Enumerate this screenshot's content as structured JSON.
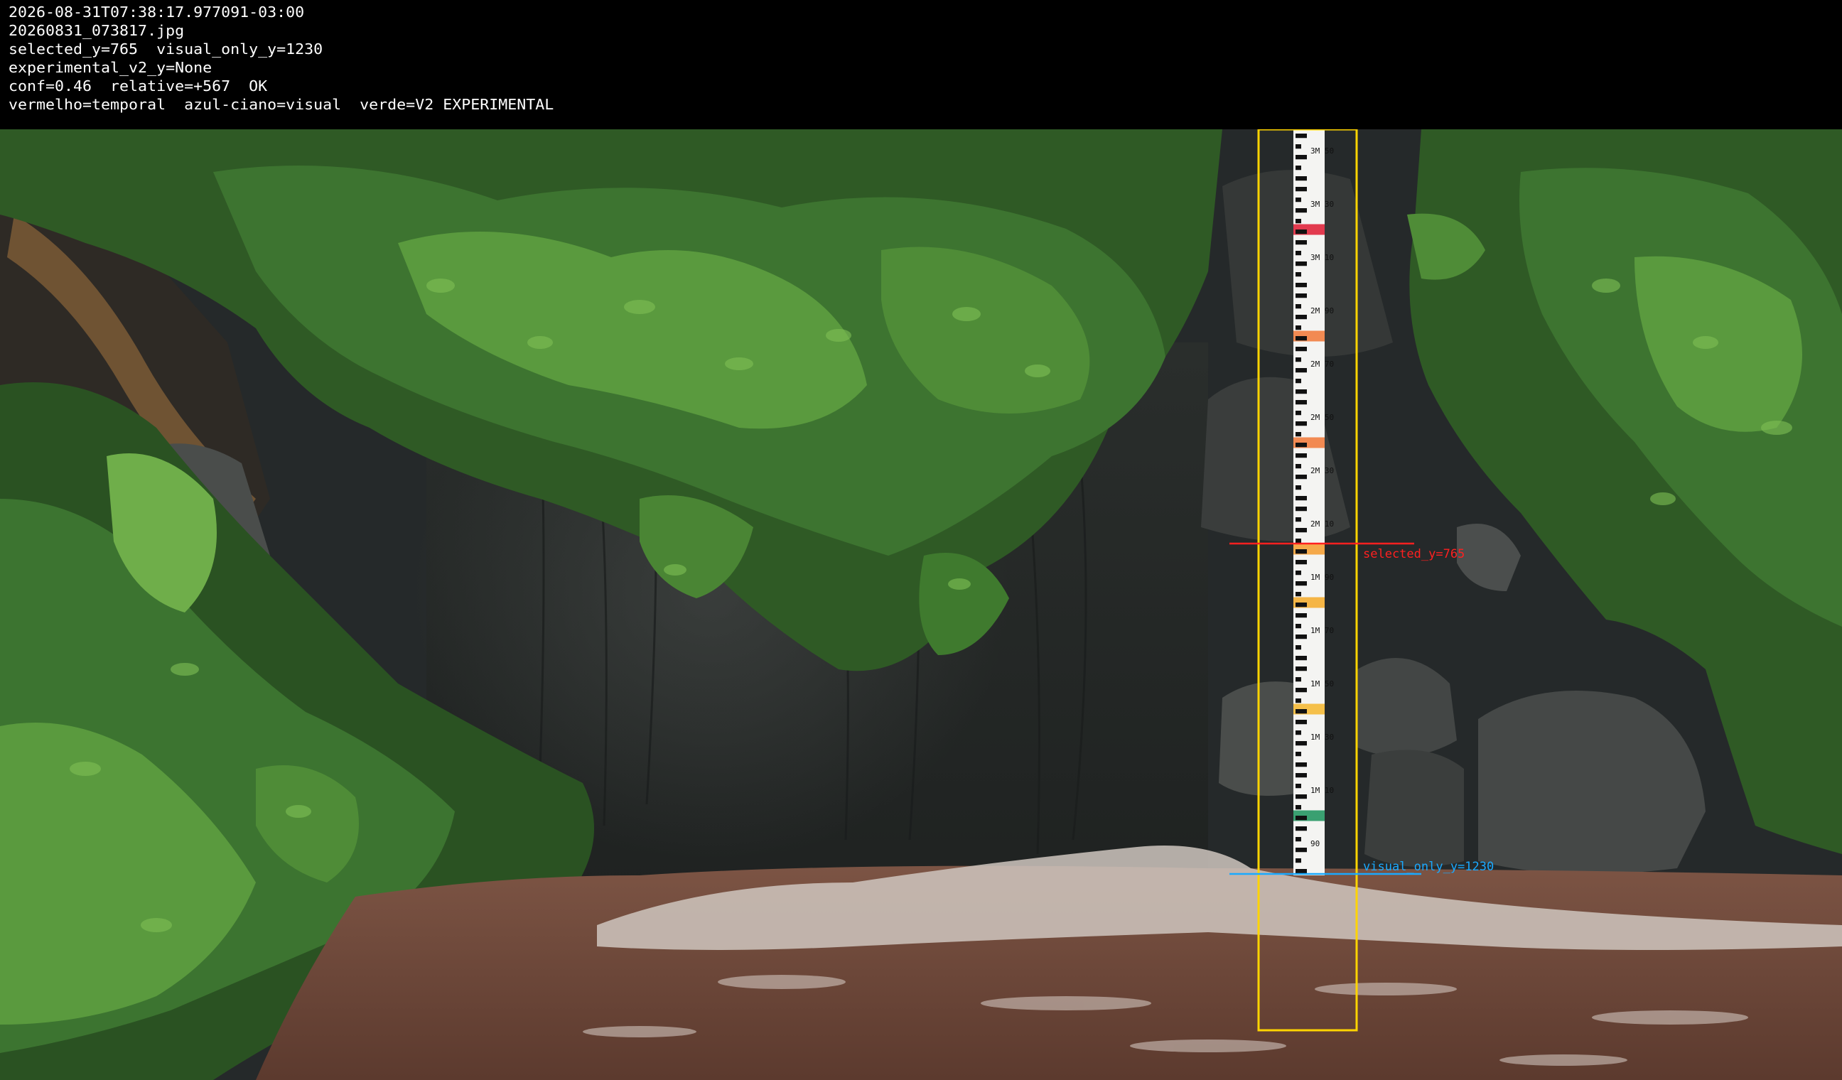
{
  "header": {
    "timestamp": "2026-08-31T07:38:17.977091-03:00",
    "filename": "20260831_073817.jpg",
    "selection": "selected_y=765  visual_only_y=1230",
    "experimental": "experimental_v2_y=None",
    "confidence": "conf=0.46  relative=+567  OK",
    "legend": "vermelho=temporal  azul-ciano=visual  verde=V2 EXPERIMENTAL"
  },
  "overlays": {
    "selected_label": "selected_y=765",
    "visual_label": "visual_only_y=1230",
    "colors": {
      "selected": "#ff2020",
      "visual": "#1aa9ff",
      "roi": "#ffd400"
    }
  },
  "gauge": {
    "labels": [
      "3M 50",
      "3M 30",
      "3M 10",
      "2M 90",
      "2M 70",
      "2M 50",
      "2M 30",
      "2M 10",
      "1M 90",
      "1M 70",
      "1M 50",
      "1M 30",
      "1M 10",
      "90"
    ],
    "band_colors": [
      "#e23a4e",
      "#f28a52",
      "#f28a52",
      "#f5a94a",
      "#f5b545",
      "#f5c04a",
      "#3aa071"
    ]
  },
  "scene": {
    "palette": {
      "rock": "#2a2c2b",
      "foliage": "#3c7a2a",
      "foliage_light": "#6fae4a",
      "water": "#6e4a3a",
      "foam": "#d9d2cc"
    }
  }
}
